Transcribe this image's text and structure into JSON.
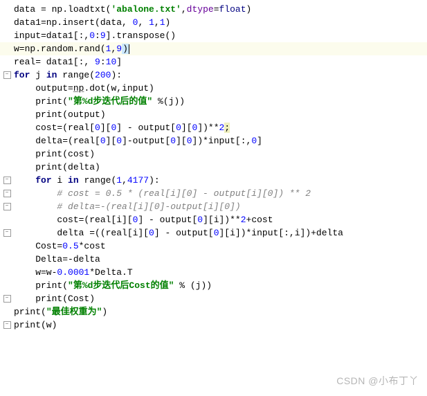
{
  "gutter": {
    "collapse": "−"
  },
  "code": {
    "l1": {
      "a": "data = np.loadtxt(",
      "b": "'abalone.txt'",
      "c": ",",
      "d": "dtype",
      "e": "=",
      "f": "float",
      "g": ")"
    },
    "l2": {
      "a": "data1=np.insert(data, ",
      "b": "0",
      "c": ", ",
      "d": "1",
      "e": ",",
      "f": "1",
      "g": ")"
    },
    "l3": {
      "a": "input=data1[:,",
      "b": "0",
      "c": ":",
      "d": "9",
      "e": "].transpose()"
    },
    "l4": {
      "a": "w=np.random.rand(",
      "b": "1",
      "c": ",",
      "d": "9",
      "e": ")"
    },
    "l5": {
      "a": "real= data1[:, ",
      "b": "9",
      "c": ":",
      "d": "10",
      "e": "]"
    },
    "l6": {
      "a": "for",
      "b": " j ",
      "c": "in",
      "d": " range(",
      "e": "200",
      "f": "):"
    },
    "l7": {
      "a": "    output=",
      "b": "np",
      "c": ".dot(w,input)"
    },
    "l8": {
      "a": "    print(",
      "b": "\"第%d步迭代后的值\"",
      "c": " %(j))"
    },
    "l9": "    print(output)",
    "l10": {
      "a": "    cost=(real[",
      "b": "0",
      "c": "][",
      "d": "0",
      "e": "] - output[",
      "f": "0",
      "g": "][",
      "h": "0",
      "i": "])**",
      "j": "2",
      "k": ";"
    },
    "l11": {
      "a": "    delta=(real[",
      "b": "0",
      "c": "][",
      "d": "0",
      "e": "]-output[",
      "f": "0",
      "g": "][",
      "h": "0",
      "i": "])*input[:,",
      "j": "0",
      "k": "]"
    },
    "l12": "    print(cost)",
    "l13": "    print(delta)",
    "l14": {
      "a": "    ",
      "b": "for",
      "c": " i ",
      "d": "in",
      "e": " range(",
      "f": "1",
      "g": ",",
      "h": "4177",
      "i": "):"
    },
    "l15": "        # cost = 0.5 * (real[i][0] - output[i][0]) ** 2",
    "l16": "        # delta=-(real[i][0]-output[i][0])",
    "l17": {
      "a": "        cost=(real[i][",
      "b": "0",
      "c": "] - output[",
      "d": "0",
      "e": "][i])**",
      "f": "2",
      "g": "+cost"
    },
    "l18": {
      "a": "        delta =((real[i][",
      "b": "0",
      "c": "] - output[",
      "d": "0",
      "e": "][i])*input[:,i])+delta"
    },
    "l19": {
      "a": "    Cost=",
      "b": "0.5",
      "c": "*cost"
    },
    "l20": "    Delta=-delta",
    "l21": {
      "a": "    w=w-",
      "b": "0.0001",
      "c": "*Delta.T"
    },
    "l22": {
      "a": "    print(",
      "b": "\"第%d步迭代后Cost的值\"",
      "c": " % (j))"
    },
    "l23": "    print(Cost)",
    "l24": {
      "a": "print(",
      "b": "\"最佳权重为\"",
      "c": ")"
    },
    "l25": "print(w)"
  },
  "watermark": "CSDN @小布丁丫"
}
